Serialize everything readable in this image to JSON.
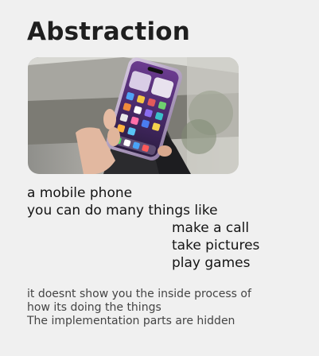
{
  "slide": {
    "title": "Abstraction",
    "photo_alt": "hand holding a mobile phone",
    "lines": {
      "l1": "a mobile phone",
      "l2": "you can do many things like",
      "l3": "make a call",
      "l4": "take pictures",
      "l5": "play games"
    },
    "notes": {
      "n1": "it doesnt show you the inside process of",
      "n2": "how its doing the things",
      "n3": "The implementation parts are hidden"
    }
  },
  "colors": {
    "background": "#f0f0f0",
    "title": "#1f1f1f",
    "body_text": "#141414",
    "note_text": "#444444",
    "phone_frame": "#b9a6c8",
    "phone_screen": "#5a2f7e"
  }
}
